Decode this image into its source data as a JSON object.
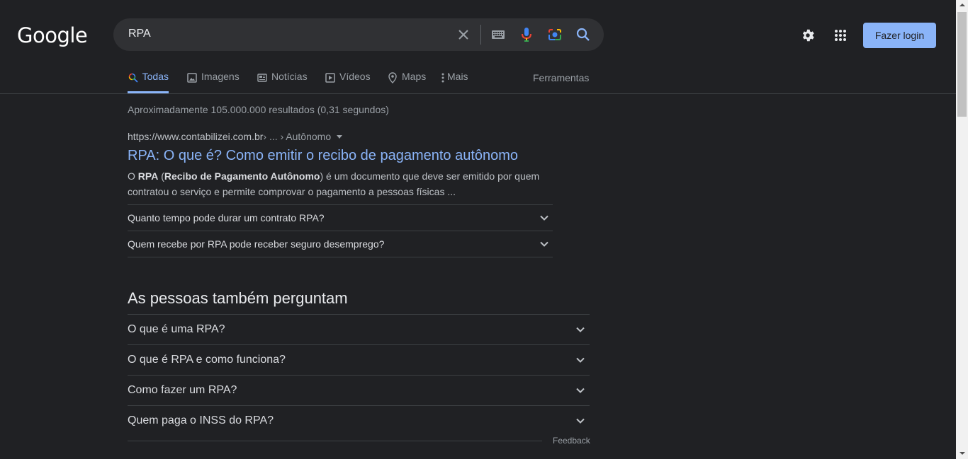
{
  "header": {
    "logo": "Google",
    "search": {
      "query": "RPA"
    },
    "login_label": "Fazer login"
  },
  "tabs": [
    {
      "label": "Todas",
      "icon": "search-icon",
      "active": true
    },
    {
      "label": "Imagens",
      "icon": "image-icon"
    },
    {
      "label": "Notícias",
      "icon": "news-icon"
    },
    {
      "label": "Vídeos",
      "icon": "video-icon"
    },
    {
      "label": "Maps",
      "icon": "map-pin-icon"
    },
    {
      "label": "Mais",
      "icon": "more-vert-icon"
    }
  ],
  "tools_label": "Ferramentas",
  "stats": "Aproximadamente 105.000.000 resultados (0,31 segundos)",
  "result": {
    "url_host": "https://www.contabilizei.com.br",
    "url_path": " › ... › Autônomo",
    "title": "RPA: O que é? Como emitir o recibo de pagamento autônomo",
    "snippet": {
      "p1": "O ",
      "b1": "RPA",
      "p2": " (",
      "b2": "Recibo de Pagamento Autônomo",
      "p3": ") é um documento que deve ser emitido por quem contratou o serviço e permite comprovar o pagamento a pessoas físicas ..."
    },
    "faqs": [
      "Quanto tempo pode durar um contrato RPA?",
      "Quem recebe por RPA pode receber seguro desemprego?"
    ]
  },
  "people_also_ask": {
    "heading": "As pessoas também perguntam",
    "questions": [
      "O que é uma RPA?",
      "O que é RPA e como funciona?",
      "Como fazer um RPA?",
      "Quem paga o INSS do RPA?"
    ],
    "feedback": "Feedback"
  },
  "colors": {
    "background": "#202124",
    "link": "#8ab4f8",
    "login_button": "#8ab4f8"
  }
}
